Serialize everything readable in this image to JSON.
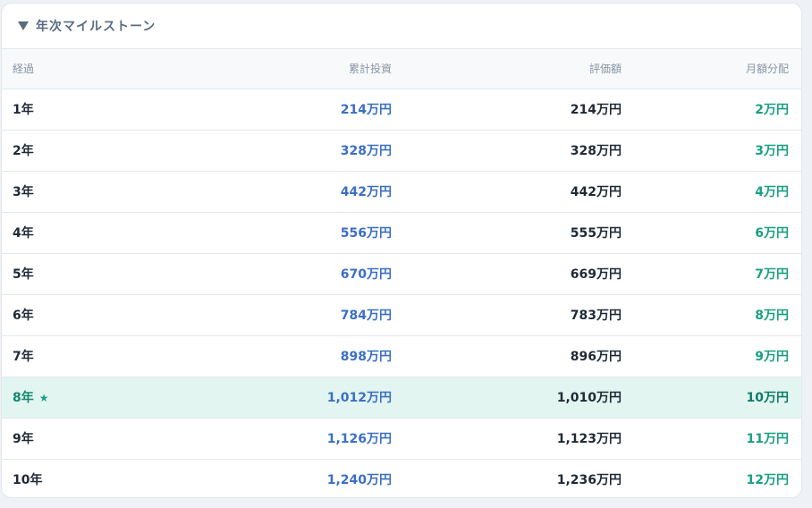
{
  "section": {
    "title": "年次マイルストーン"
  },
  "table": {
    "headers": {
      "period": "経過",
      "cumulative_investment": "累計投資",
      "valuation": "評価額",
      "monthly_distribution": "月額分配"
    },
    "rows": [
      {
        "period": "1年",
        "cumulative_investment": "214万円",
        "valuation": "214万円",
        "monthly_distribution": "2万円"
      },
      {
        "period": "2年",
        "cumulative_investment": "328万円",
        "valuation": "328万円",
        "monthly_distribution": "3万円"
      },
      {
        "period": "3年",
        "cumulative_investment": "442万円",
        "valuation": "442万円",
        "monthly_distribution": "4万円"
      },
      {
        "period": "4年",
        "cumulative_investment": "556万円",
        "valuation": "555万円",
        "monthly_distribution": "6万円"
      },
      {
        "period": "5年",
        "cumulative_investment": "670万円",
        "valuation": "669万円",
        "monthly_distribution": "7万円"
      },
      {
        "period": "6年",
        "cumulative_investment": "784万円",
        "valuation": "783万円",
        "monthly_distribution": "8万円"
      },
      {
        "period": "7年",
        "cumulative_investment": "898万円",
        "valuation": "896万円",
        "monthly_distribution": "9万円"
      },
      {
        "period": "8年",
        "cumulative_investment": "1,012万円",
        "valuation": "1,010万円",
        "monthly_distribution": "10万円",
        "star": "★"
      },
      {
        "period": "9年",
        "cumulative_investment": "1,126万円",
        "valuation": "1,123万円",
        "monthly_distribution": "11万円"
      },
      {
        "period": "10年",
        "cumulative_investment": "1,240万円",
        "valuation": "1,236万円",
        "monthly_distribution": "12万円"
      }
    ]
  },
  "colors": {
    "investment": "#3b6fc4",
    "distribution": "#1aa083",
    "highlight_bg": "#e3f5f1"
  }
}
